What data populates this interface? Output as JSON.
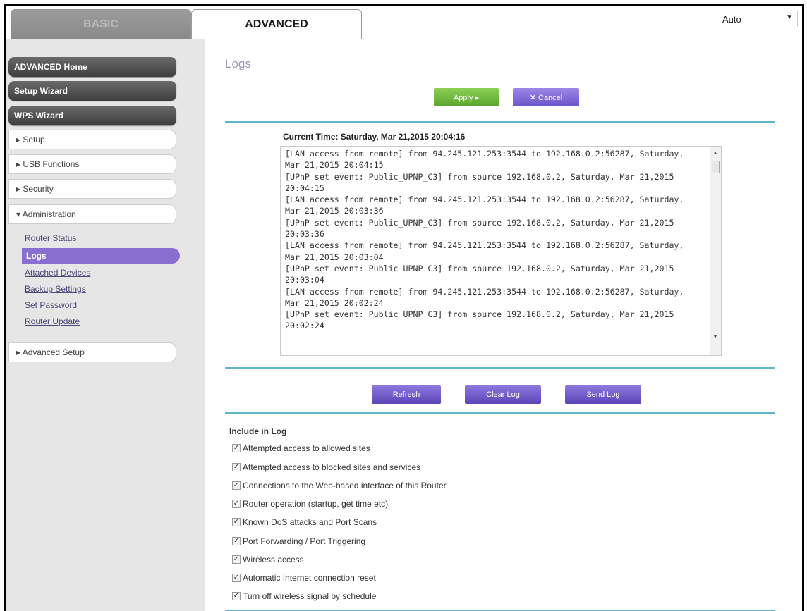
{
  "tabs": {
    "basic": "BASIC",
    "advanced": "ADVANCED"
  },
  "language": {
    "value": "Auto"
  },
  "sidebar": {
    "dark_buttons": [
      "ADVANCED Home",
      "Setup Wizard",
      "WPS Wizard"
    ],
    "menu": [
      "▸ Setup",
      "▸ USB Functions",
      "▸ Security",
      "▾ Administration"
    ],
    "sub_links": [
      "Router Status",
      "Logs",
      "Attached Devices",
      "Backup Settings",
      "Set Password",
      "Router Update"
    ],
    "active_sub": "Logs",
    "advanced_setup": "▸ Advanced Setup"
  },
  "main": {
    "title": "Logs",
    "apply": "Apply ▸",
    "cancel": "✕ Cancel",
    "current_time": "Current Time: Saturday, Mar 21,2015 20:04:16",
    "log_text": "[LAN access from remote] from 94.245.121.253:3544 to 192.168.0.2:56287, Saturday, Mar 21,2015 20:04:15\n[UPnP set event: Public_UPNP_C3] from source 192.168.0.2, Saturday, Mar 21,2015 20:04:15\n[LAN access from remote] from 94.245.121.253:3544 to 192.168.0.2:56287, Saturday, Mar 21,2015 20:03:36\n[UPnP set event: Public_UPNP_C3] from source 192.168.0.2, Saturday, Mar 21,2015 20:03:36\n[LAN access from remote] from 94.245.121.253:3544 to 192.168.0.2:56287, Saturday, Mar 21,2015 20:03:04\n[UPnP set event: Public_UPNP_C3] from source 192.168.0.2, Saturday, Mar 21,2015 20:03:04\n[LAN access from remote] from 94.245.121.253:3544 to 192.168.0.2:56287, Saturday, Mar 21,2015 20:02:24\n[UPnP set event: Public_UPNP_C3] from source 192.168.0.2, Saturday, Mar 21,2015 20:02:24",
    "refresh": "Refresh",
    "clear_log": "Clear Log",
    "send_log": "Send Log",
    "include_title": "Include in Log",
    "include_items": [
      "Attempted access to allowed sites",
      "Attempted access to blocked sites and services",
      "Connections to the Web-based interface of this Router",
      "Router operation (startup, get time etc)",
      "Known DoS attacks and Port Scans",
      "Port Forwarding / Port Triggering",
      "Wireless access",
      "Automatic Internet connection reset",
      "Turn off wireless signal by schedule"
    ],
    "checked": true
  },
  "colors": {
    "accent_purple": "#8a6fd1",
    "apply_green": "#6cb83b",
    "divider": "#5fb6c8"
  }
}
